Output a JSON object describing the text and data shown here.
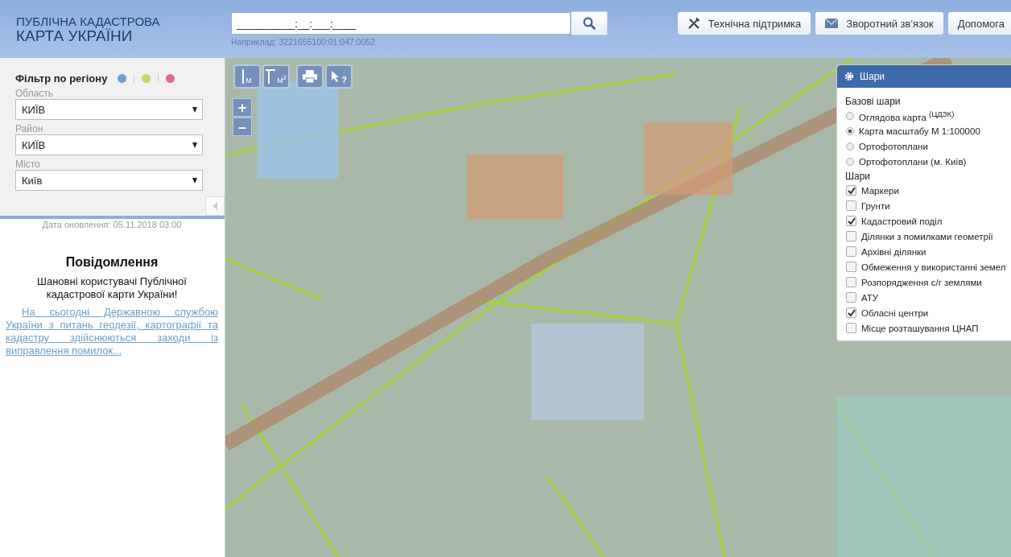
{
  "header": {
    "title_line_1": "ПУБЛІЧНА КАДАСТРОВА",
    "title_line_2": "КАРТА УКРАЇНИ",
    "search": {
      "value": "__________:__:___:____",
      "hint": "Наприклад: 3221655100:01:047:0052"
    },
    "buttons": [
      {
        "kind": "tools",
        "label": "Технічна підтримка"
      },
      {
        "kind": "mail",
        "label": "Зворотний зв'язок"
      },
      {
        "kind": "plain",
        "label": "Допомога"
      }
    ]
  },
  "filter": {
    "title": "Фільтр по регіону",
    "dots": [
      {
        "color": "#6aa3d5"
      },
      {
        "color": "#c8d66a"
      },
      {
        "color": "#de6b87"
      }
    ],
    "fields": [
      {
        "label": "Область",
        "value": "КИЇВ"
      },
      {
        "label": "Район",
        "value": "КИЇВ"
      },
      {
        "label": "Місто",
        "value": "Київ"
      }
    ]
  },
  "update_date": "Дата оновлення: 05.11.2018 03:00",
  "notice": {
    "title": "Повідомлення",
    "greeting": "Шановні користувачі Публічної кадастрової карти України!",
    "link": "На сьогодні Державною службою України з питань геодезії, картографії та кадастру здійснюються заходи із виправлення помилок..."
  },
  "map_tools": [
    {
      "kind": "distance",
      "label": "М"
    },
    {
      "kind": "area",
      "label": "М$^{2}$"
    },
    {
      "kind": "print"
    },
    {
      "kind": "info",
      "label": "?"
    }
  ],
  "zoom": {
    "in": "+",
    "out": "–"
  },
  "layers_panel": {
    "title": "Шари",
    "base_title": "Базові шари",
    "base_layers": [
      {
        "label": "Оглядова карта $^{(ЦДЗК)}$",
        "selected": false
      },
      {
        "label": "Карта масштабу М 1:100000",
        "selected": true
      },
      {
        "label": "Ортофотоплани",
        "selected": false
      },
      {
        "label": "Ортофотоплани (м. Київ)",
        "selected": false
      }
    ],
    "layers_title": "Шари",
    "layers": [
      {
        "label": "Маркери",
        "checked": true
      },
      {
        "label": "Грунти",
        "checked": false
      },
      {
        "label": "Кадастровий поділ",
        "checked": true
      },
      {
        "label": "Ділянки з помилками геометрії",
        "checked": false
      },
      {
        "label": "Архівні ділянки",
        "checked": false
      },
      {
        "label": "Обмеження у використанні земел",
        "checked": false
      },
      {
        "label": "Розпорядження с/г землями",
        "checked": false
      },
      {
        "label": "АТУ",
        "checked": false
      },
      {
        "label": "Обласні центри",
        "checked": true
      },
      {
        "label": "Місце розташування ЦНАП",
        "checked": false
      }
    ]
  }
}
